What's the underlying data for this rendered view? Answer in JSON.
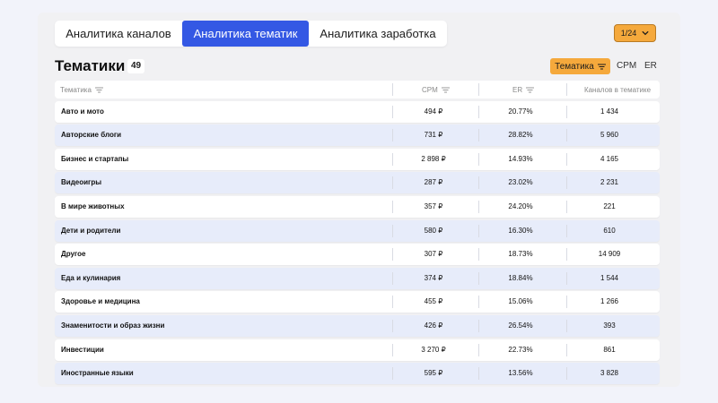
{
  "tabs": [
    {
      "label": "Аналитика каналов",
      "active": false
    },
    {
      "label": "Аналитика тематик",
      "active": true
    },
    {
      "label": "Аналитика заработка",
      "active": false
    }
  ],
  "pager": {
    "label": "1/24",
    "icon": "chevron-down-icon"
  },
  "heading": {
    "title": "Тематики",
    "count": "49"
  },
  "sort": {
    "active_label": "Тематика",
    "options": [
      "CPM",
      "ER"
    ]
  },
  "table": {
    "headers": [
      "Тематика",
      "CPM",
      "ER",
      "Каналов в тематике"
    ],
    "rows": [
      {
        "name": "Авто и мото",
        "cpm": "494 ₽",
        "er": "20.77%",
        "count": "1 434"
      },
      {
        "name": "Авторские блоги",
        "cpm": "731 ₽",
        "er": "28.82%",
        "count": "5 960"
      },
      {
        "name": "Бизнес и стартапы",
        "cpm": "2 898 ₽",
        "er": "14.93%",
        "count": "4 165"
      },
      {
        "name": "Видеоигры",
        "cpm": "287 ₽",
        "er": "23.02%",
        "count": "2 231"
      },
      {
        "name": "В мире животных",
        "cpm": "357 ₽",
        "er": "24.20%",
        "count": "221"
      },
      {
        "name": "Дети и родители",
        "cpm": "580 ₽",
        "er": "16.30%",
        "count": "610"
      },
      {
        "name": "Другое",
        "cpm": "307 ₽",
        "er": "18.73%",
        "count": "14 909"
      },
      {
        "name": "Еда и кулинария",
        "cpm": "374 ₽",
        "er": "18.84%",
        "count": "1 544"
      },
      {
        "name": "Здоровье и медицина",
        "cpm": "455 ₽",
        "er": "15.06%",
        "count": "1 266"
      },
      {
        "name": "Знаменитости и образ жизни",
        "cpm": "426 ₽",
        "er": "26.54%",
        "count": "393"
      },
      {
        "name": "Инвестиции",
        "cpm": "3 270 ₽",
        "er": "22.73%",
        "count": "861"
      },
      {
        "name": "Иностранные языки",
        "cpm": "595 ₽",
        "er": "13.56%",
        "count": "3 828"
      }
    ]
  },
  "colors": {
    "accent_blue": "#3458e4",
    "accent_orange": "#f5a93c",
    "row_tint": "#e7ecfa"
  }
}
